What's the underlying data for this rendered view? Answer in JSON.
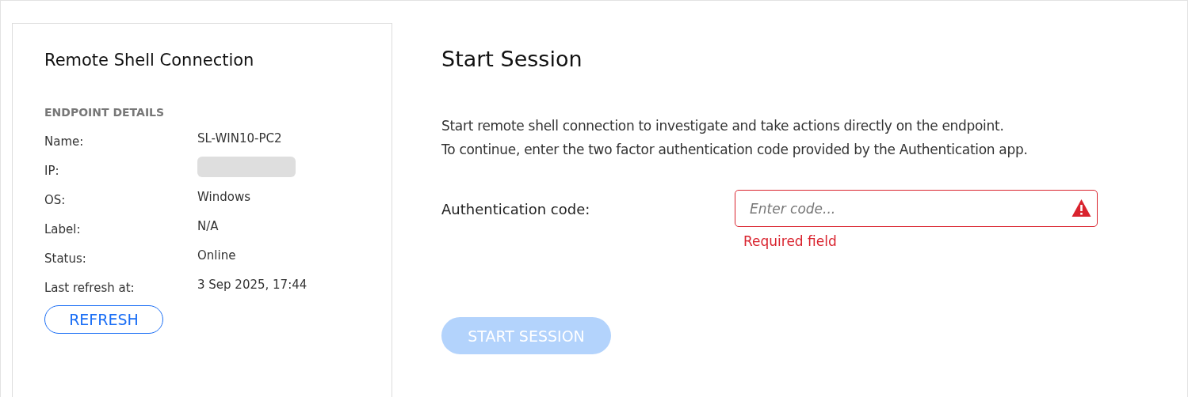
{
  "sidebar": {
    "title": "Remote Shell Connection",
    "section": "ENDPOINT DETAILS",
    "details": [
      {
        "label": "Name:",
        "kind": "text",
        "value": "SL-WIN10-PC2"
      },
      {
        "label": "IP:",
        "kind": "redacted"
      },
      {
        "label": "OS:",
        "kind": "text",
        "value": "Windows"
      },
      {
        "label": "Label:",
        "kind": "text",
        "value": "N/A"
      },
      {
        "label": "Status:",
        "kind": "text",
        "value": "Online"
      },
      {
        "label": "Last refresh at:",
        "kind": "text",
        "value": "3 Sep 2025, 17:44"
      }
    ],
    "refresh_button": {
      "label": "REFRESH"
    }
  },
  "main": {
    "title": "Start Session",
    "description": [
      "Start remote shell connection to investigate and take actions directly on the endpoint.",
      "To continue, enter the two factor authentication code provided by the Authentication app."
    ],
    "code_field": {
      "label": "Authentication code:",
      "placeholder": "Enter code...",
      "invalid": true,
      "error": "Required field"
    },
    "start_button": {
      "label": "START SESSION",
      "disabled": true
    }
  }
}
